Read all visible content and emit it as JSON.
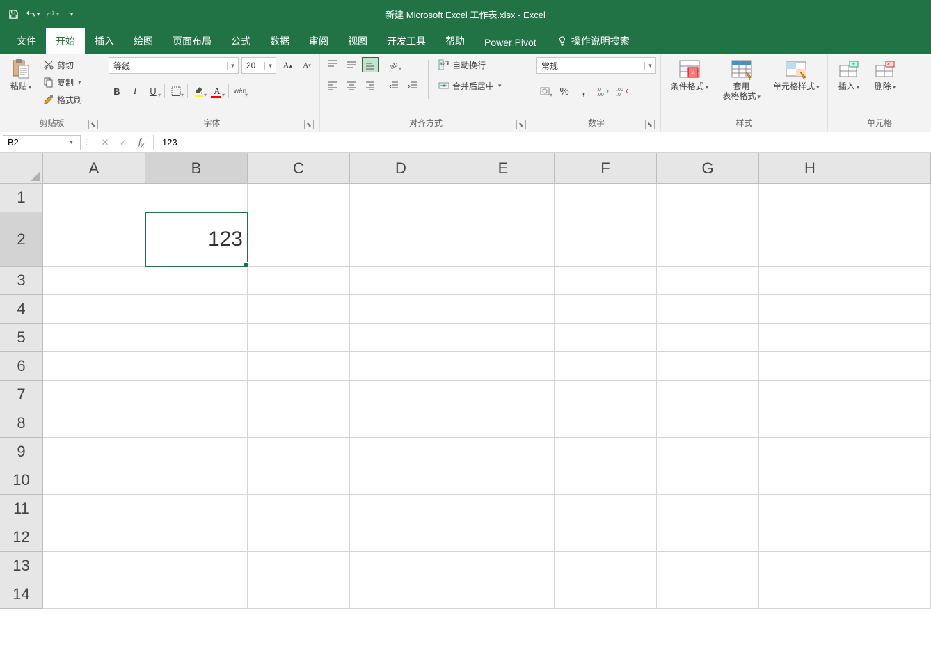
{
  "titlebar": {
    "title": "新建 Microsoft Excel 工作表.xlsx  -  Excel"
  },
  "tabs": {
    "file": "文件",
    "home": "开始",
    "insert": "插入",
    "draw": "绘图",
    "pagelayout": "页面布局",
    "formulas": "公式",
    "data": "数据",
    "review": "审阅",
    "view": "视图",
    "developer": "开发工具",
    "help": "帮助",
    "powerpivot": "Power Pivot",
    "tellme": "操作说明搜索"
  },
  "ribbon": {
    "clipboard": {
      "label": "剪贴板",
      "paste": "粘贴",
      "cut": "剪切",
      "copy": "复制",
      "format_painter": "格式刷"
    },
    "font": {
      "label": "字体",
      "name": "等线",
      "size": "20",
      "bold": "B",
      "italic": "I",
      "underline": "U",
      "pinyin": "wén"
    },
    "alignment": {
      "label": "对齐方式",
      "wrap": "自动换行",
      "merge": "合并后居中"
    },
    "number": {
      "label": "数字",
      "format": "常规"
    },
    "styles": {
      "label": "样式",
      "cond": "条件格式",
      "table": "套用\n表格格式",
      "cell": "单元格样式"
    },
    "cells": {
      "label": "单元格",
      "insert": "插入",
      "delete": "删除"
    }
  },
  "formula_bar": {
    "name_box": "B2",
    "formula": "123"
  },
  "grid": {
    "columns": [
      "A",
      "B",
      "C",
      "D",
      "E",
      "F",
      "G",
      "H"
    ],
    "rows": [
      "1",
      "2",
      "3",
      "4",
      "5",
      "6",
      "7",
      "8",
      "9",
      "10",
      "11",
      "12",
      "13",
      "14"
    ],
    "active_cell": "B2",
    "active_col_index": 1,
    "active_row_index": 1,
    "big_row_index": 1,
    "cells": {
      "B2": "123"
    }
  }
}
